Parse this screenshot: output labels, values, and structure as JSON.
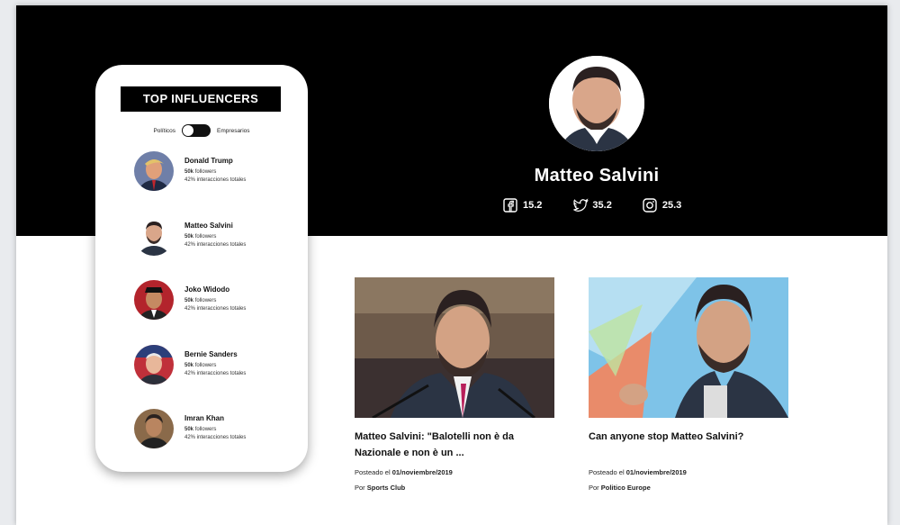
{
  "profile": {
    "name": "Matteo Salvini",
    "stats": {
      "facebook": "15.2",
      "twitter": "35.2",
      "instagram": "25.3"
    }
  },
  "influencers_panel": {
    "title": "TOP INFLUENCERS",
    "toggle_left": "Políticos",
    "toggle_right": "Empresarios",
    "items": [
      {
        "name": "Donald Trump",
        "followers_value": "50k",
        "followers_label": "followers",
        "interactions": "42% interacciones totales"
      },
      {
        "name": "Matteo Salvini",
        "followers_value": "50k",
        "followers_label": "followers",
        "interactions": "42% interacciones totales"
      },
      {
        "name": "Joko Widodo",
        "followers_value": "50k",
        "followers_label": "followers",
        "interactions": "42% interacciones totales"
      },
      {
        "name": "Bernie Sanders",
        "followers_value": "50k",
        "followers_label": "followers",
        "interactions": "42% interacciones totales"
      },
      {
        "name": "Imran Khan",
        "followers_value": "50k",
        "followers_label": "followers",
        "interactions": "42% interacciones totales"
      }
    ]
  },
  "articles": [
    {
      "title": "Matteo Salvini: \"Balotelli non è da Nazionale e non è un ...",
      "posted_label": "Posteado el",
      "posted_date": "01/noviembre/2019",
      "by_label": "Por",
      "source": "Sports Club"
    },
    {
      "title": "Can anyone stop Matteo Salvini?",
      "posted_label": "Posteado el",
      "posted_date": "01/noviembre/2019",
      "by_label": "Por",
      "source": "Politico Europe"
    }
  ],
  "colors": {
    "hero_bg": "#000000",
    "card_bg": "#ffffff",
    "text": "#111111"
  }
}
